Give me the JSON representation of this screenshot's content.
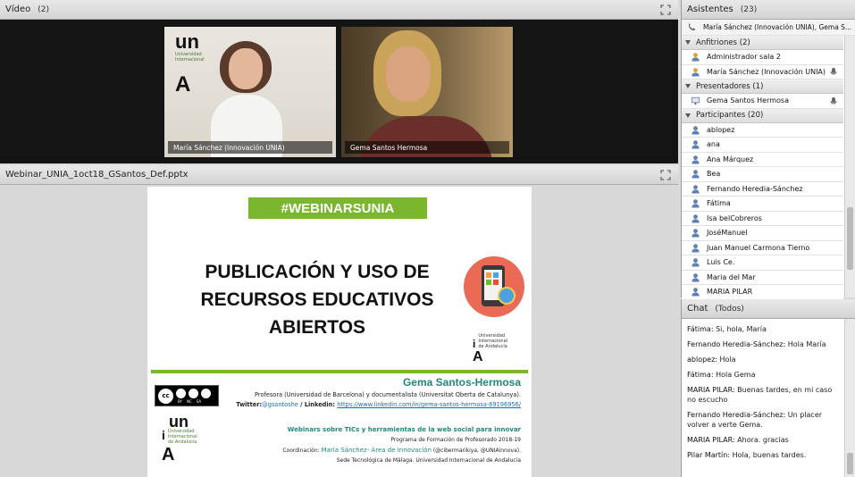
{
  "video_pod": {
    "title": "Vídeo",
    "count": "(2)",
    "feeds": [
      {
        "name": "María Sánchez (Innovación UNIA)"
      },
      {
        "name": "Gema Santos Hermosa"
      }
    ]
  },
  "share_pod": {
    "title": "Webinar_UNIA_1oct18_GSantos_Def.pptx"
  },
  "slide": {
    "hashtag": "#WEBINARSUNIA",
    "title_line1": "PUBLICACIÓN Y USO DE",
    "title_line2": "RECURSOS EDUCATIVOS",
    "title_line3": "ABIERTOS",
    "presenter": "Gema Santos-Hermosa",
    "affiliation": "Profesora (Universidad de Barcelona) y documentalista (Universitat Oberta de Catalunya).",
    "twitter_label": "Twitter:",
    "twitter_handle": "@gsantoshe",
    "linkedin_sep": " / Linkedin: ",
    "linkedin_url": "https://www.linkedin.com/in/gema-santos-hermosa-69196956/",
    "series_title": "Webinars sobre TICs y herramientas de la web social para innovar",
    "program": "Programa de Formación de Profesorado 2018-19",
    "coord_label": "Coordinación: ",
    "coord_name": "María Sánchez- Área de Innovación",
    "coord_handles": " (@cibermarikiya, @UNIAinnova).",
    "sede": "Sede Tecnológica de Málaga. Universidad Internacional de Andalucía",
    "logo_uni": "un",
    "logo_i": "i",
    "logo_a": "A",
    "logo_text1": "Universidad",
    "logo_text2": "Internacional",
    "logo_text3": "de Andalucía",
    "cc_labels": [
      "BY",
      "NC",
      "SA"
    ]
  },
  "attendees": {
    "title": "Asistentes",
    "count": "(23)",
    "speaking": "María Sánchez (Innovación UNIA), Gema S...",
    "sections": [
      {
        "label": "Anfitriones (2)",
        "people": [
          "Administrador sala 2",
          "María Sánchez (Innovación UNIA)"
        ]
      },
      {
        "label": "Presentadores (1)",
        "people": [
          "Gema Santos Hermosa"
        ]
      },
      {
        "label": "Participantes (20)",
        "people": [
          "ablopez",
          "ana",
          "Ana Márquez",
          "Bea",
          "Fernando Heredia-Sánchez",
          "Fátima",
          "Isa belCobreros",
          "JoséManuel",
          "Juan Manuel Carmona Tierno",
          "Luis Ce.",
          "Maria del Mar",
          "MARIA PILAR"
        ]
      }
    ]
  },
  "chat": {
    "title": "Chat",
    "scope": "(Todos)",
    "messages": [
      {
        "author": "Fátima:",
        "text": " Si, hola, María"
      },
      {
        "author": "Fernando Heredia-Sánchez:",
        "text": " Hola María"
      },
      {
        "author": "ablopez:",
        "text": " Hola"
      },
      {
        "author": "Fátima:",
        "text": " Hola Gema"
      },
      {
        "author": "MARIA PILAR:",
        "text": " Buenas tardes, en mi caso no escucho"
      },
      {
        "author": "Fernando Heredia-Sánchez:",
        "text": " Un placer volver a verte Gema."
      },
      {
        "author": "MARIA PILAR:",
        "text": " Ahora. gracias"
      },
      {
        "author": "Pilar Martín:",
        "text": " Hola, buenas tardes."
      }
    ]
  },
  "colors": {
    "accent_green": "#7ab72e",
    "teal": "#1e8a7a"
  }
}
